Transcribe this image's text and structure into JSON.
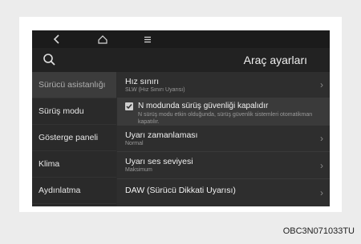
{
  "topbar": {
    "back_icon": "chevron-left-icon",
    "home_icon": "home-icon",
    "menu_icon": "menu-icon"
  },
  "header": {
    "search_icon": "search-icon",
    "title": "Araç ayarları"
  },
  "sidebar": {
    "items": [
      {
        "label": "Sürücü asistanlığı",
        "selected": true
      },
      {
        "label": "Sürüş modu",
        "selected": false
      },
      {
        "label": "Gösterge paneli",
        "selected": false
      },
      {
        "label": "Klima",
        "selected": false
      },
      {
        "label": "Aydınlatma",
        "selected": false
      }
    ]
  },
  "content": {
    "items": [
      {
        "label": "Hız sınırı",
        "sub": "SLW (Hız Sınırı Uyarısı)"
      },
      {
        "label": "N modunda sürüş güvenliği kapalıdır",
        "sub": "N sürüş modu etkin olduğunda, sürüş güvenlik sistemleri otomatikman kapatılır.",
        "checked": true
      },
      {
        "label": "Uyarı zamanlaması",
        "sub": "Normal"
      },
      {
        "label": "Uyarı ses seviyesi",
        "sub": "Maksimum"
      },
      {
        "label": "DAW (Sürücü Dikkati Uyarısı)",
        "sub": ""
      }
    ]
  },
  "caption": "OBC3N071033TU",
  "colors": {
    "screen_bg": "#2c2c2c",
    "topbar_bg": "#1b1b1b",
    "selected_bg": "#3c3c3c"
  }
}
